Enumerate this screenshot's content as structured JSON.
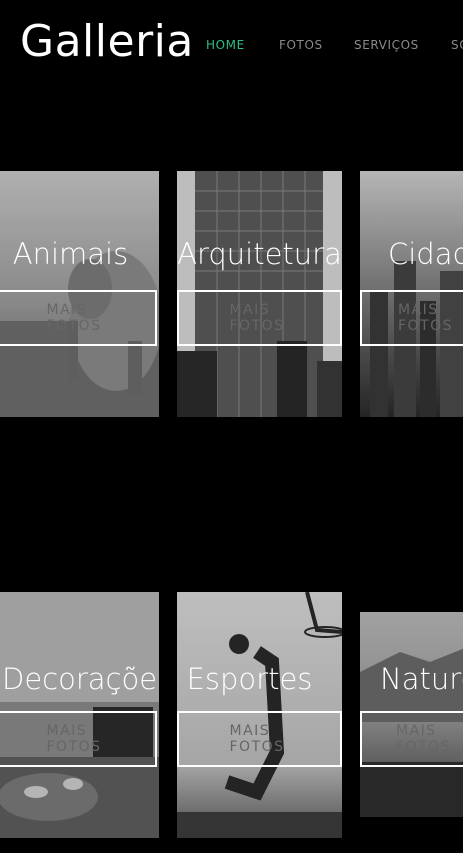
{
  "header": {
    "logo": "Galleria"
  },
  "nav": {
    "items": [
      {
        "label": "HOME",
        "active": true
      },
      {
        "label": "FOTOS",
        "active": false
      },
      {
        "label": "SERVIÇOS",
        "active": false
      },
      {
        "label": "SO",
        "active": false
      }
    ]
  },
  "gallery": {
    "button_label": "MAIS FOTOS",
    "tiles": [
      {
        "title": "Animais",
        "icon": "elephant-photo"
      },
      {
        "title": "Arquitetura",
        "icon": "skyscraper-photo"
      },
      {
        "title": "Cidades",
        "icon": "city-photo"
      },
      {
        "title": "Decorações",
        "icon": "coffee-table-photo"
      },
      {
        "title": "Esportes",
        "icon": "basketball-photo"
      },
      {
        "title": "Natureza",
        "icon": "landscape-photo"
      }
    ]
  },
  "colors": {
    "accent": "#2fbf83",
    "background": "#000000",
    "nav_text": "#8a8a8a"
  }
}
